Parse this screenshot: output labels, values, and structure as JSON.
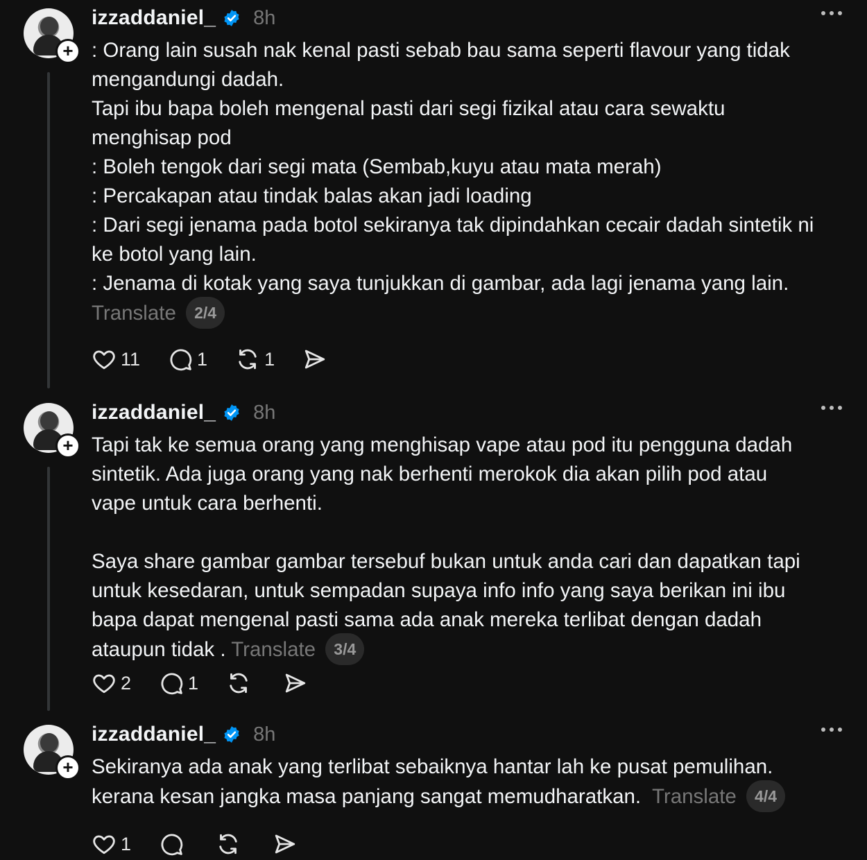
{
  "posts": [
    {
      "username": "izzaddaniel_",
      "time": "8h",
      "text": ": Orang lain susah nak kenal pasti sebab bau sama seperti flavour yang tidak\nmengandungi dadah.\nTapi ibu bapa boleh mengenal pasti dari segi fizikal atau cara sewaktu\nmenghisap pod\n: Boleh tengok dari segi mata (Sembab,kuyu atau mata merah)\n: Percakapan atau tindak balas akan jadi loading\n: Dari segi jenama pada botol sekiranya tak dipindahkan cecair dadah sintetik ni\nke botol yang lain.\n: Jenama di kotak yang saya tunjukkan di gambar, ada lagi jenama yang lain.\n",
      "translate": "Translate",
      "pager": "2/4",
      "likes": "11",
      "replies": "1",
      "reposts": "1"
    },
    {
      "username": "izzaddaniel_",
      "time": "8h",
      "text": "Tapi tak ke semua orang yang menghisap vape atau pod itu pengguna dadah\nsintetik. Ada juga orang yang nak berhenti merokok dia akan pilih pod atau\nvape untuk cara berhenti.\n\nSaya share gambar gambar tersebuf bukan untuk anda cari dan dapatkan tapi\nuntuk kesedaran, untuk sempadan supaya info info yang saya berikan ini ibu\nbapa dapat mengenal pasti sama ada anak mereka terlibat dengan dadah\nataupun tidak . ",
      "translate": "Translate",
      "pager": "3/4",
      "likes": "2",
      "replies": "1",
      "reposts": ""
    },
    {
      "username": "izzaddaniel_",
      "time": "8h",
      "text": "Sekiranya ada anak yang terlibat sebaiknya hantar lah ke pusat pemulihan.\nkerana kesan jangka masa panjang sangat memudharatkan.  ",
      "translate": "Translate",
      "pager": "4/4",
      "likes": "1",
      "replies": "",
      "reposts": ""
    }
  ],
  "icons": {
    "like": "heart-icon",
    "reply": "comment-icon",
    "repost": "repost-icon",
    "share": "send-icon",
    "verified": "verified-badge-icon",
    "more": "more-options-icon",
    "follow": "plus-icon"
  },
  "colors": {
    "background": "#101010",
    "text": "#f3f5f7",
    "muted": "#777777",
    "verified": "#0095f6"
  }
}
